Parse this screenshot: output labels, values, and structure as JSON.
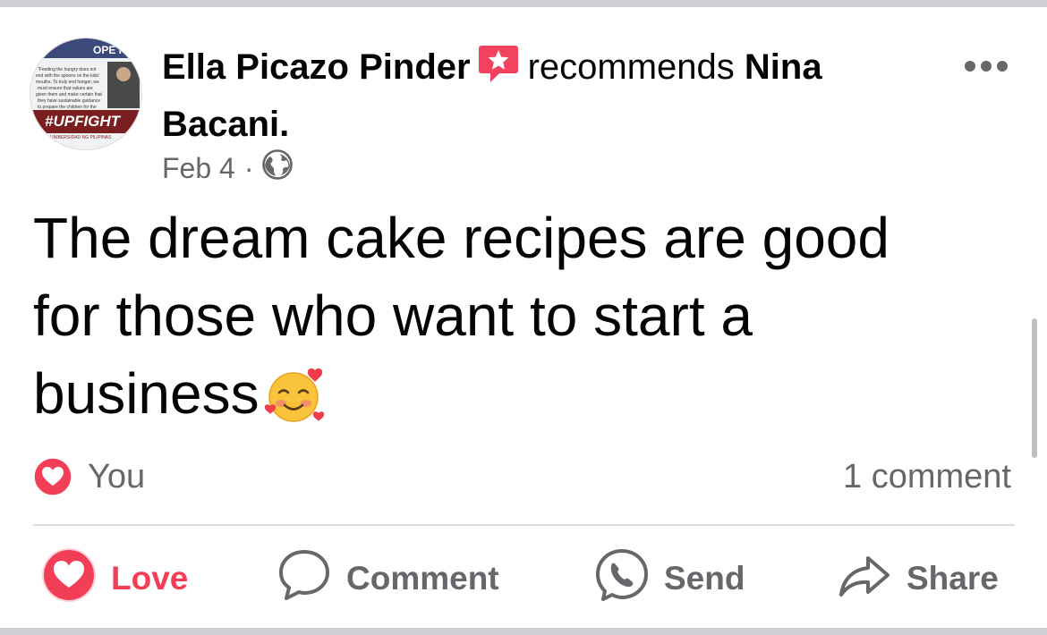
{
  "post": {
    "author": "Ella Picazo Pinder",
    "recommends_word": "recommends",
    "recommended_name": "Nina",
    "recommended_name_cont": "Bacani.",
    "date": "Feb 4",
    "separator": "·",
    "visibility_icon": "globe-icon",
    "body_line1": "The dream cake recipes are good",
    "body_line2": "for those who want to start a",
    "body_line3": "business",
    "emoji": "smiling-face-with-hearts-icon"
  },
  "avatar": {
    "banner_text": "OPE KITC",
    "quote_text": "Feeding the hungry does not end with the spoons on the kids' mouths. To truly end hunger, we must ensure that values are given them and make certain that they have sustainable guidance to prepare the children for the",
    "hashtag": "#UPFIGHT",
    "university": "UNIBERSIDAD NG PILIPINAS"
  },
  "reactions": {
    "reactor": "You",
    "reaction_icon": "love-reaction-icon",
    "comment_count": "1 comment"
  },
  "actions": {
    "love": "Love",
    "comment": "Comment",
    "send": "Send",
    "share": "Share"
  },
  "colors": {
    "love": "#f33e58",
    "secondary_text": "#65676b",
    "primary_text": "#050505",
    "recommend_badge": "#f3425f"
  }
}
